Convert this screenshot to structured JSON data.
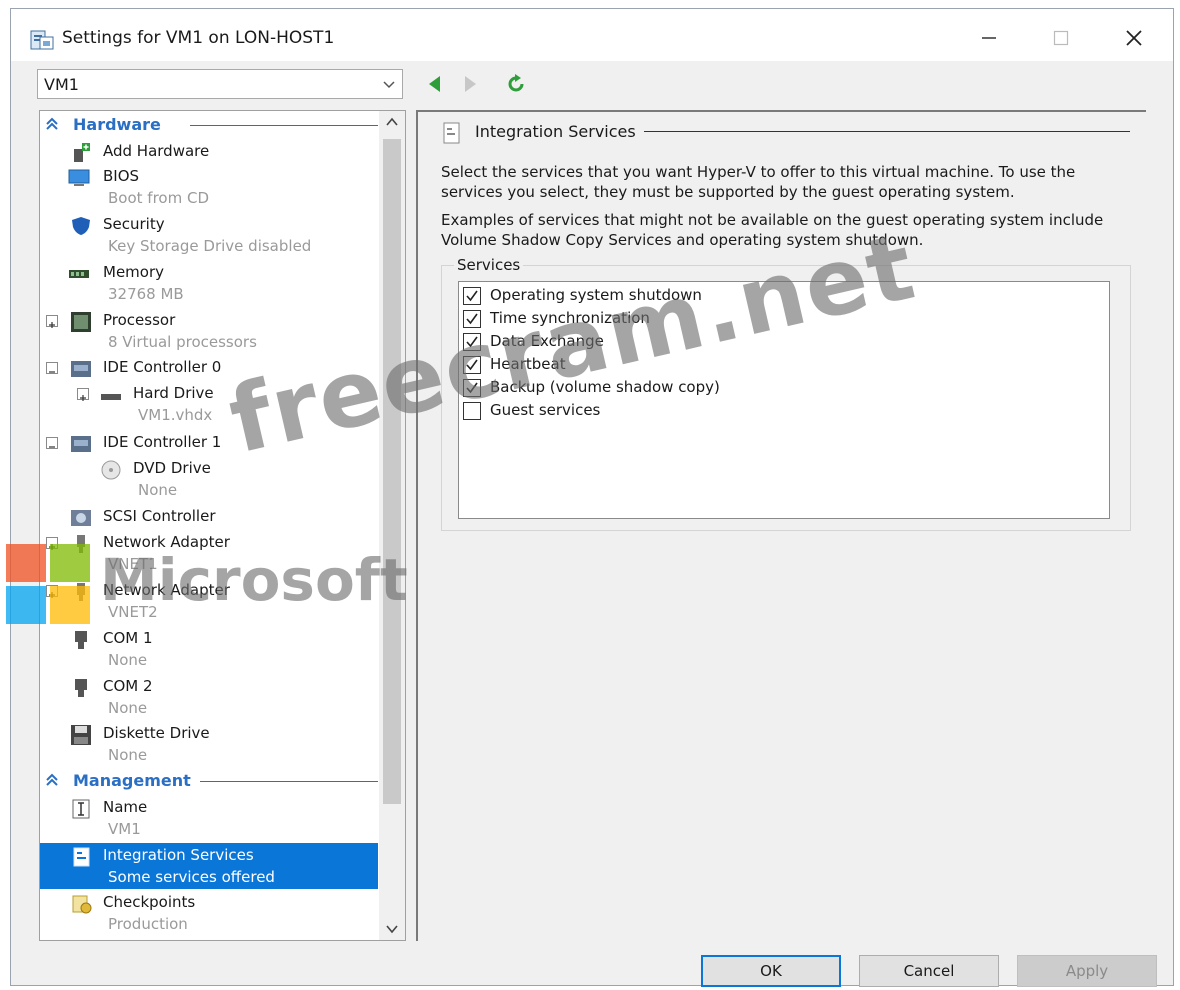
{
  "window": {
    "title": "Settings for VM1 on LON-HOST1"
  },
  "vm_selector": {
    "value": "VM1"
  },
  "hardware": {
    "label": "Hardware",
    "items": [
      {
        "name": "Add Hardware",
        "sub": ""
      },
      {
        "name": "BIOS",
        "sub": "Boot from CD"
      },
      {
        "name": "Security",
        "sub": "Key Storage Drive disabled"
      },
      {
        "name": "Memory",
        "sub": "32768 MB"
      },
      {
        "name": "Processor",
        "sub": "8 Virtual processors"
      },
      {
        "name": "IDE Controller 0",
        "sub": ""
      },
      {
        "name": "Hard Drive",
        "sub": "VM1.vhdx"
      },
      {
        "name": "IDE Controller 1",
        "sub": ""
      },
      {
        "name": "DVD Drive",
        "sub": "None"
      },
      {
        "name": "SCSI Controller",
        "sub": ""
      },
      {
        "name": "Network Adapter",
        "sub": "VNET1"
      },
      {
        "name": "Network Adapter",
        "sub": "VNET2"
      },
      {
        "name": "COM 1",
        "sub": "None"
      },
      {
        "name": "COM 2",
        "sub": "None"
      },
      {
        "name": "Diskette Drive",
        "sub": "None"
      }
    ]
  },
  "management": {
    "label": "Management",
    "items": [
      {
        "name": "Name",
        "sub": "VM1"
      },
      {
        "name": "Integration Services",
        "sub": "Some services offered"
      },
      {
        "name": "Checkpoints",
        "sub": "Production"
      }
    ]
  },
  "detail": {
    "title": "Integration Services",
    "desc1": "Select the services that you want Hyper-V to offer to this virtual machine. To use the services you select, they must be supported by the guest operating system.",
    "desc2": "Examples of services that might not be available on the guest operating system include Volume Shadow Copy Services and operating system shutdown.",
    "services_label": "Services",
    "services": [
      {
        "label": "Operating system shutdown",
        "checked": true
      },
      {
        "label": "Time synchronization",
        "checked": true
      },
      {
        "label": "Data Exchange",
        "checked": true
      },
      {
        "label": "Heartbeat",
        "checked": true
      },
      {
        "label": "Backup (volume shadow copy)",
        "checked": true
      },
      {
        "label": "Guest services",
        "checked": false
      }
    ]
  },
  "buttons": {
    "ok": "OK",
    "cancel": "Cancel",
    "apply": "Apply"
  },
  "watermark": {
    "site": "freecram.net",
    "brand": "Microsoft"
  },
  "colors": {
    "accent": "#0a76d8",
    "section": "#2a6fc4",
    "nav_green": "#2e9e3a"
  }
}
